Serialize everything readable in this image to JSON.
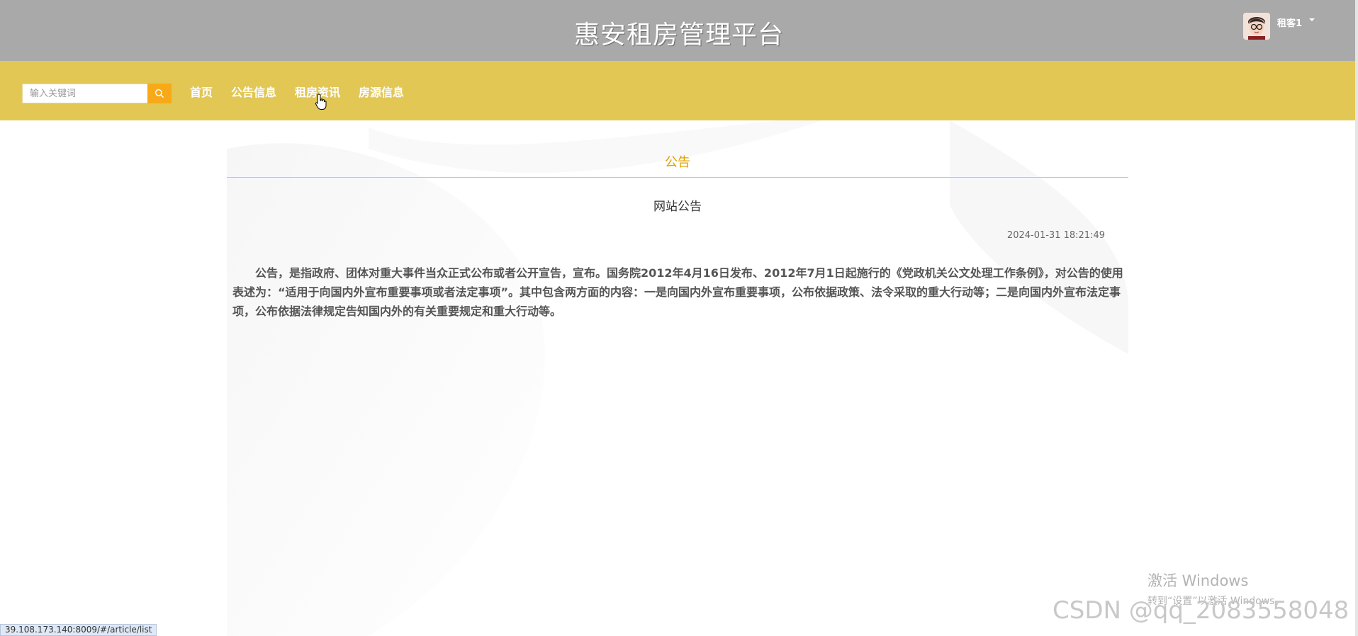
{
  "header": {
    "site_title": "惠安租房管理平台",
    "user_name": "租客1"
  },
  "nav": {
    "search_placeholder": "输入关键词",
    "links": [
      {
        "label": "首页"
      },
      {
        "label": "公告信息"
      },
      {
        "label": "租房资讯"
      },
      {
        "label": "房源信息"
      }
    ]
  },
  "article": {
    "section_title": "公告",
    "title": "网站公告",
    "date": "2024-01-31 18:21:49",
    "body": "公告，是指政府、团体对重大事件当众正式公布或者公开宣告，宣布。国务院2012年4月16日发布、2012年7月1日起施行的《党政机关公文处理工作条例》，对公告的使用表述为：“适用于向国内外宣布重要事项或者法定事项”。其中包含两方面的内容：一是向国内外宣布重要事项，公布依据政策、法令采取的重大行动等；二是向国内外宣布法定事项，公布依据法律规定告知国内外的有关重要规定和重大行动等。"
  },
  "status_bar": {
    "url": "39.108.173.140:8009/#/article/list"
  },
  "overlay": {
    "windows_line1": "激活 Windows",
    "windows_line2": "转到“设置”以激活 Windows。",
    "csdn_watermark": "CSDN @qq_2083558048"
  },
  "colors": {
    "header_bg": "#a9a9a9",
    "nav_bg": "#e2c755",
    "accent": "#e0a100",
    "search_button": "#f7a918"
  },
  "icons": {
    "search": "search-icon",
    "caret": "chevron-down-icon",
    "cursor": "hand-pointer-icon"
  }
}
